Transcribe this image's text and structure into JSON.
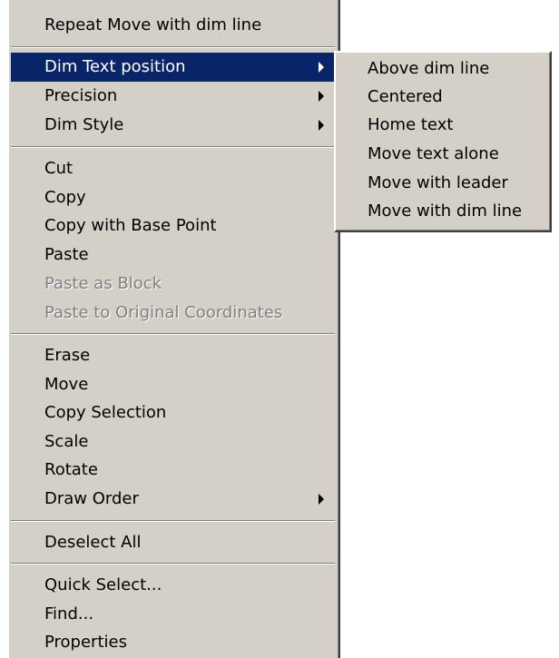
{
  "context_menu": {
    "repeat": "Repeat Move with dim line",
    "dim_text_position": "Dim Text position",
    "precision": "Precision",
    "dim_style": "Dim Style",
    "cut": "Cut",
    "copy": "Copy",
    "copy_base_point": "Copy with Base Point",
    "paste": "Paste",
    "paste_as_block": "Paste as Block",
    "paste_original": "Paste to Original Coordinates",
    "erase": "Erase",
    "move": "Move",
    "copy_selection": "Copy Selection",
    "scale": "Scale",
    "rotate": "Rotate",
    "draw_order": "Draw Order",
    "deselect_all": "Deselect All",
    "quick_select": "Quick Select...",
    "find": "Find...",
    "properties": "Properties"
  },
  "submenu": {
    "above_dim_line": "Above dim line",
    "centered": "Centered",
    "home_text": "Home text",
    "move_text_alone": "Move text alone",
    "move_with_leader": "Move with leader",
    "move_with_dim_line": "Move with dim line"
  },
  "icons": {
    "submenu_arrow": "submenu-arrow-icon"
  },
  "colors": {
    "menu_bg": "#d4d0c8",
    "selection": "#0a246a",
    "disabled_text": "#808080"
  }
}
